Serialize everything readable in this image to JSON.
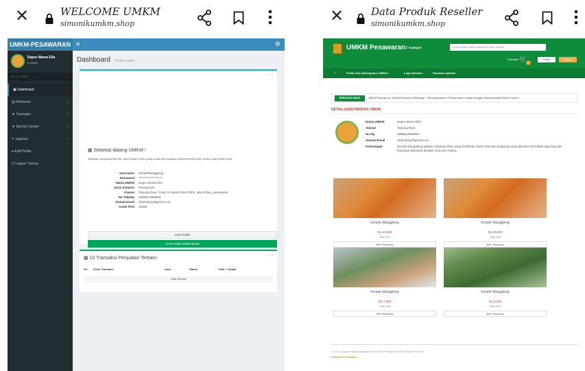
{
  "left": {
    "browser": {
      "title": "WELCOME UMKM",
      "url": "simonikumkm.shop"
    },
    "admin": {
      "logo": "UMKM-PESAWARAN",
      "sidebar": {
        "user_name": "Dapur Mama Ella",
        "user_status": "● Online",
        "menu_header": "MENU UMKM",
        "items": [
          {
            "label": "Dashboard",
            "icon": "dashboard-icon"
          },
          {
            "label": "Referensi",
            "icon": "table-icon"
          },
          {
            "label": "Transaksi",
            "icon": "cart-icon"
          },
          {
            "label": "Service Center",
            "icon": "cart-icon"
          },
          {
            "label": "Laporan",
            "icon": "pencil-icon"
          },
          {
            "label": "Edit Profile",
            "icon": "user-icon"
          },
          {
            "label": "Logout / Keluar",
            "icon": "power-icon"
          }
        ]
      },
      "content": {
        "title": "Dashboard",
        "subtitle": "Control panel",
        "welcome": "Selamat datang UMKM !",
        "description": "Silahkan mengelola fitur-fitur data melalui menu yang sudah kita sediakan disebelah kiri anda, berikut data profile anda",
        "profile": [
          {
            "k": "Username",
            "v": "KeripikManggleng"
          },
          {
            "k": "Password",
            "v": "********************"
          },
          {
            "k": "Nama UMKM",
            "v": "Dapur Mama Ella"
          },
          {
            "k": "Jenis Kelamin",
            "v": "Perempuan"
          },
          {
            "k": "Alamat",
            "v": "Tanjung Rejo, Gang Air Mandi rt/rw 03/01, way khilau, pesawaran"
          },
          {
            "k": "No Telp/Hp",
            "v": "0895615059984"
          },
          {
            "k": "Alamat Email",
            "v": "ellachubyy@gmail.com"
          },
          {
            "k": "Kode POS",
            "v": "35368"
          }
        ],
        "edit_button": "Edit Profile",
        "portal_button": "Lihat Portal UMKM anda!",
        "transactions": {
          "title": "10 Transaksi Penjualan Terbaru",
          "columns": [
            "No",
            "Kode Transaksi",
            "Kurir",
            "Status",
            "Total + Ongkir"
          ],
          "view_all": "Lihat Semua"
        }
      }
    }
  },
  "right": {
    "browser": {
      "title": "Data Produk Reseller",
      "url": "simonikumkm.shop"
    },
    "shop": {
      "brand": "UMKM Pesawaran",
      "kategori": "Kategori",
      "search_placeholder": "Ketik Disini Untuk Mencari Produk UMKM...",
      "transaksi": "Transaksi",
      "cart_count": "0",
      "daftar": "Daftar",
      "masuk": "Masuk",
      "nav": [
        "Profile Dan Marketplace UMKM ▾",
        "Login Member",
        "Panduan Aplikasi"
      ],
      "breaking_tag": "BREAKING NEWS",
      "breaking_text": "UMKM Bersiap Go Global Bersama Whatsapp · Memaksimalkan Perlumbuhan Usaha Dengan Meminimalkan Risiko Usaha ·",
      "detail_title": "DETAIL DATA PRODUK UMKM",
      "detail": [
        {
          "k": "Nama UMKM",
          "v": "Dapur Mama Ella"
        },
        {
          "k": "Alamat",
          "v": "Tanjung Rejo"
        },
        {
          "k": "No Hp",
          "v": "0895615059984"
        },
        {
          "k": "Alamat Email",
          "v": "ellachubyy@gmail.com"
        },
        {
          "k": "Keterangan",
          "v": "Keripik Manggleng adalah makanan khas yang berbahan dasar rebusan singkong yang diproses kemudian digoreng dan biasanya dikumbui dengan rasa asin manis."
        }
      ],
      "products": [
        {
          "name": "Keripik Manggleng",
          "price": "Rp 40,000",
          "stock": "Stok 100",
          "buy": "Beli Sekarang"
        },
        {
          "name": "Keripik Manggleng",
          "price": "Rp 20,000",
          "stock": "Stok 100",
          "buy": "Beli Sekarang"
        },
        {
          "name": "Keripik Manggleng",
          "price": "Rp 7,000",
          "stock": "Stok 100",
          "buy": "Beli Sekarang"
        },
        {
          "name": "Keripik Manggleng",
          "price": "Rp 5,000",
          "stock": "Stok 100",
          "buy": "Beli Sekarang"
        }
      ],
      "copyright": "© 2023 Copyright Sistem Digitalisasi dan UMKM Pesawaran Mode. All Rights reserved.",
      "footer_brand": "UMKM Kab Pesawaran"
    }
  }
}
